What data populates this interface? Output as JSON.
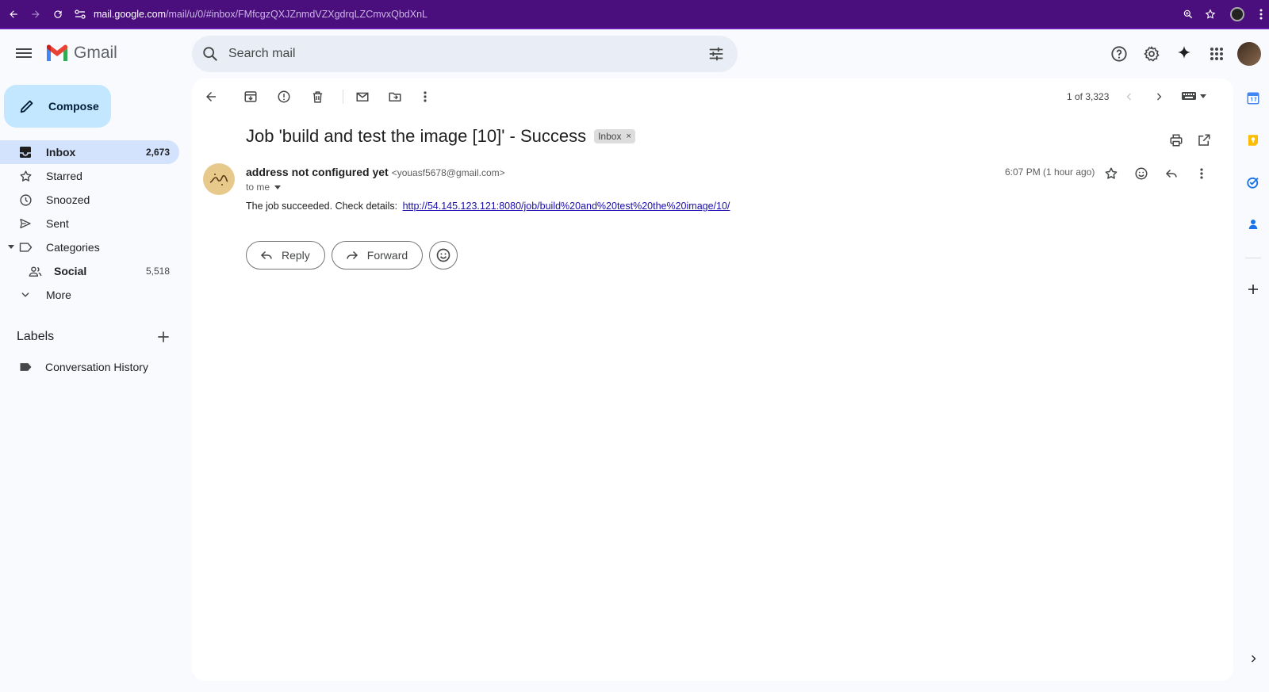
{
  "browser": {
    "url_host": "mail.google.com",
    "url_path": "/mail/u/0/#inbox/FMfcgzQXJZnmdVZXgdrqLZCmvxQbdXnL"
  },
  "header": {
    "app_name": "Gmail",
    "search_placeholder": "Search mail"
  },
  "sidebar": {
    "compose_label": "Compose",
    "items": [
      {
        "label": "Inbox",
        "count": "2,673",
        "icon": "inbox-icon"
      },
      {
        "label": "Starred",
        "count": "",
        "icon": "star-icon"
      },
      {
        "label": "Snoozed",
        "count": "",
        "icon": "clock-icon"
      },
      {
        "label": "Sent",
        "count": "",
        "icon": "send-icon"
      },
      {
        "label": "Categories",
        "count": "",
        "icon": "label-outline-icon"
      },
      {
        "label": "Social",
        "count": "5,518",
        "icon": "people-icon"
      },
      {
        "label": "More",
        "count": "",
        "icon": "chevron-down-icon"
      }
    ],
    "labels_title": "Labels",
    "labels": [
      {
        "label": "Conversation History"
      }
    ]
  },
  "toolbar": {
    "pager_text": "1 of 3,323"
  },
  "message": {
    "subject": "Job 'build and test the image [10]' - Success",
    "tag": "Inbox",
    "tag_close": "×",
    "sender_name": "address not configured yet",
    "sender_email": "<youasf5678@gmail.com>",
    "to": "to me",
    "time": "6:07 PM (1 hour ago)",
    "body_prefix": "The job succeeded. Check details:",
    "body_link": "http://54.145.123.121:8080/job/build%20and%20test%20the%20image/10/",
    "reply_label": "Reply",
    "forward_label": "Forward"
  },
  "colors": {
    "accent": "#0b57d0",
    "compose_bg": "#c2e7ff",
    "active_nav": "#d3e3fd",
    "browser_bar": "#4a0f7d"
  }
}
